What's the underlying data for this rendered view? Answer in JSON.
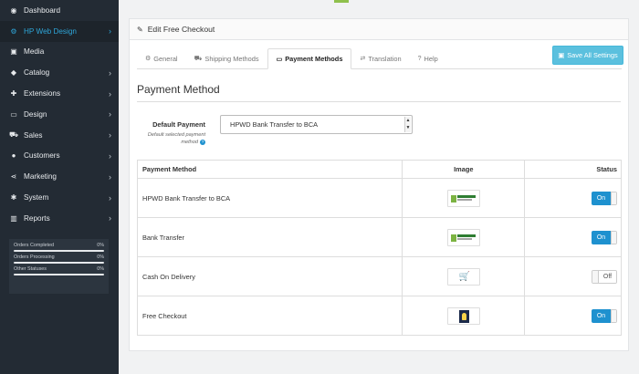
{
  "sidebar": {
    "items": [
      {
        "label": "Dashboard",
        "icon": "dashboard-icon",
        "glyph": "◉",
        "chevron": ""
      },
      {
        "label": "HP Web Design",
        "icon": "cogs-icon",
        "glyph": "⚙",
        "chevron": "›"
      },
      {
        "label": "Media",
        "icon": "image-icon",
        "glyph": "▣",
        "chevron": ""
      },
      {
        "label": "Catalog",
        "icon": "tag-icon",
        "glyph": "◆",
        "chevron": "›"
      },
      {
        "label": "Extensions",
        "icon": "puzzle-icon",
        "glyph": "✚",
        "chevron": "›"
      },
      {
        "label": "Design",
        "icon": "monitor-icon",
        "glyph": "▭",
        "chevron": "›"
      },
      {
        "label": "Sales",
        "icon": "cart-icon",
        "glyph": "⛟",
        "chevron": "›"
      },
      {
        "label": "Customers",
        "icon": "user-icon",
        "glyph": "●",
        "chevron": "›"
      },
      {
        "label": "Marketing",
        "icon": "share-icon",
        "glyph": "⋖",
        "chevron": "›"
      },
      {
        "label": "System",
        "icon": "gear-icon",
        "glyph": "✱",
        "chevron": "›"
      },
      {
        "label": "Reports",
        "icon": "bar-chart-icon",
        "glyph": "▥",
        "chevron": "›"
      }
    ],
    "stats": [
      {
        "label": "Orders Completed",
        "value": "0%"
      },
      {
        "label": "Orders Processing",
        "value": "0%"
      },
      {
        "label": "Other Statuses",
        "value": "0%"
      }
    ]
  },
  "panel": {
    "title": "Edit Free Checkout",
    "save_label": "Save All Settings",
    "tabs": [
      {
        "label": "General",
        "glyph": "⚙"
      },
      {
        "label": "Shipping Methods",
        "glyph": "⛟"
      },
      {
        "label": "Payment Methods",
        "glyph": "▭"
      },
      {
        "label": "Translation",
        "glyph": "⇄"
      },
      {
        "label": "Help",
        "glyph": "?"
      }
    ],
    "active_tab": "Payment Methods"
  },
  "section": {
    "title": "Payment Method"
  },
  "default_payment": {
    "label": "Default Payment",
    "help": "Default selected payment method",
    "selected": "HPWD Bank Transfer to BCA"
  },
  "table": {
    "headers": [
      "Payment Method",
      "Image",
      "Status"
    ],
    "rows": [
      {
        "name": "HPWD Bank Transfer to BCA",
        "image": "kalbi-pro-logo",
        "status": "On"
      },
      {
        "name": "Bank Transfer",
        "image": "kalbi-pro-logo",
        "status": "On"
      },
      {
        "name": "Cash On Delivery",
        "image": "cart-image",
        "status": "Off"
      },
      {
        "name": "Free Checkout",
        "image": "free-checkout-image",
        "status": "On"
      }
    ]
  },
  "colors": {
    "sidebar_bg": "#232b34",
    "accent": "#1e91cf",
    "active_nav": "#2ea6d9",
    "save_button": "#5bc0de"
  }
}
